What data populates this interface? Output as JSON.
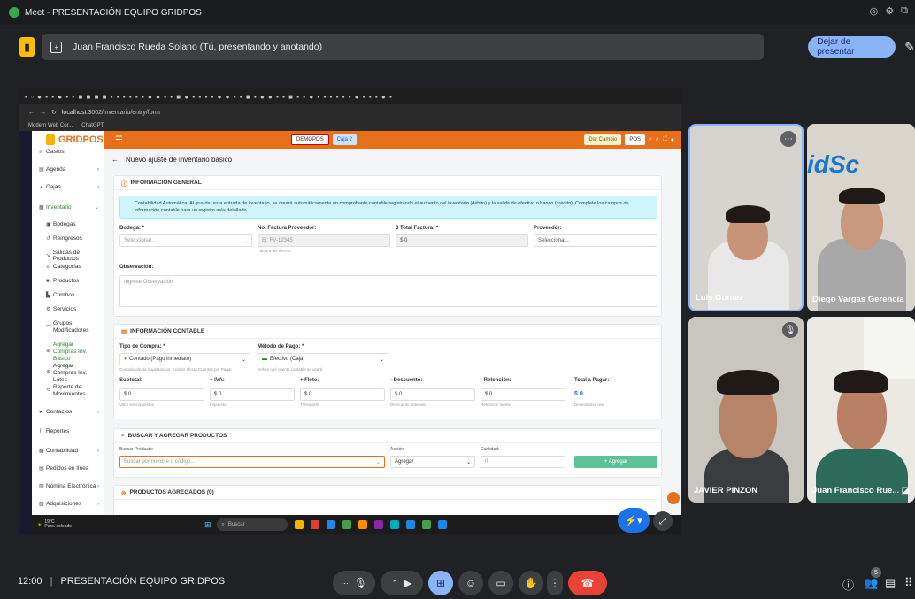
{
  "meet": {
    "window_title": "Meet - PRESENTACIÓN EQUIPO GRIDPOS",
    "presenter_text": "Juan Francisco Rueda Solano (Tú, presentando y anotando)",
    "stop_presenting_label": "Dejar de presentar",
    "clock": "12:00",
    "meeting_name": "PRESENTACIÓN EQUIPO GRIDPOS",
    "participant_count": "5",
    "participants": [
      {
        "name": "Luis Gomez"
      },
      {
        "name": "Diego Vargas Gerencia"
      },
      {
        "name": "JAVIER PINZON"
      },
      {
        "name": "Juan Francisco Rue..."
      }
    ]
  },
  "browser": {
    "url_host": "localhost",
    "url_path": ":3002/inventario/entry/form",
    "bookmarks": [
      "Modern Web Cor...",
      "ChatGPT"
    ]
  },
  "app": {
    "logo": "GRIDPOS",
    "header": {
      "chip_demopos": "DEMOPOS",
      "chip_caja": "Caja 2",
      "chip_dar_cambio": "Dar Cambio",
      "chip_pos": "POS"
    },
    "sidebar": {
      "items": [
        {
          "label": "Gastos"
        },
        {
          "label": "Agenda"
        },
        {
          "label": "Cajas"
        },
        {
          "label": "Inventario"
        },
        {
          "label": "Bodegas"
        },
        {
          "label": "Reingresos"
        },
        {
          "label": "Salidas de Productos"
        },
        {
          "label": "Categorías"
        },
        {
          "label": "Productos"
        },
        {
          "label": "Combos"
        },
        {
          "label": "Servicios"
        },
        {
          "label": "Grupos Modificadores"
        },
        {
          "label": "Agregar Compras Inv. Básico"
        },
        {
          "label": "Agregar Compras Inv. Lotes"
        },
        {
          "label": "Reporte de Movimientos"
        },
        {
          "label": "Contactos"
        },
        {
          "label": "Reportes"
        },
        {
          "label": "Contabilidad"
        },
        {
          "label": "Pedidos en línea"
        },
        {
          "label": "Nómina Electrónica"
        },
        {
          "label": "Adquisiciones"
        }
      ]
    },
    "page_title": "Nuevo ajuste de inventario básico",
    "info_general": {
      "title": "INFORMACIÓN GENERAL",
      "alert_text": "Contabilidad Automática: Al guardar esta entrada de inventario, se creará automáticamente un comprobante contable registrando el aumento del inventario (débito) y la salida de efectivo o banco (crédito). Complete los campos de información contable para un registro más detallado.",
      "bodega_label": "Bodega: *",
      "bodega_placeholder": "Seleccionar...",
      "factura_label": "No. Factura Proveedor:",
      "factura_placeholder": "Ej: FV-12345",
      "factura_help": "Factura del tercero",
      "total_label": "$ Total Factura: *",
      "total_value": "$ 0",
      "proveedor_label": "Proveedor:",
      "proveedor_placeholder": "Seleccionar...",
      "observacion_label": "Observación:",
      "observacion_placeholder": "Ingrese Observación"
    },
    "info_contable": {
      "title": "INFORMACIÓN CONTABLE",
      "tipo_label": "Tipo de Compra: *",
      "tipo_value": "Contado (Pago inmediato)",
      "tipo_help": "Contado afecta Caja/Bancos. Crédito afecta Cuentas por Pagar",
      "metodo_label": "Método de Pago: *",
      "metodo_value": "Efectivo (Caja)",
      "metodo_help": "Define qué cuenta contable se usará",
      "subtotal_label": "Subtotal:",
      "subtotal_value": "$ 0",
      "subtotal_help": "Valor sin impuestos",
      "iva_label": "+ IVA:",
      "iva_value": "$ 0",
      "iva_help": "Impuesto",
      "flete_label": "+ Flete:",
      "flete_value": "$ 0",
      "flete_help": "Transporte",
      "descuento_label": "- Descuento:",
      "descuento_value": "$ 0",
      "descuento_help": "Descuento obtenido",
      "retencion_label": "- Retención:",
      "retencion_value": "$ 0",
      "retencion_help": "Retención fuente",
      "total_pagar_label": "Total a Pagar:",
      "total_pagar_value": "$ 0",
      "total_pagar_help": "Desembolso real"
    },
    "buscar": {
      "title": "BUSCAR Y AGREGAR PRODUCTOS",
      "producto_label": "Buscar Producto:",
      "producto_placeholder": "Buscar por nombre o código...",
      "accion_label": "Acción:",
      "accion_value": "Agregar",
      "cantidad_label": "Cantidad:",
      "cantidad_value": "0",
      "agregar_button": "+ Agregar"
    },
    "productos": {
      "title": "PRODUCTOS AGREGADOS (0)"
    }
  },
  "taskbar": {
    "weather": "19°C",
    "weather_sub": "Parc. soleado",
    "search_label": "Buscar"
  },
  "colors": {
    "brand_orange": "#e8701a",
    "meet_bg": "#202124",
    "end_call": "#ea4335",
    "present_blue": "#8ab4f8"
  }
}
